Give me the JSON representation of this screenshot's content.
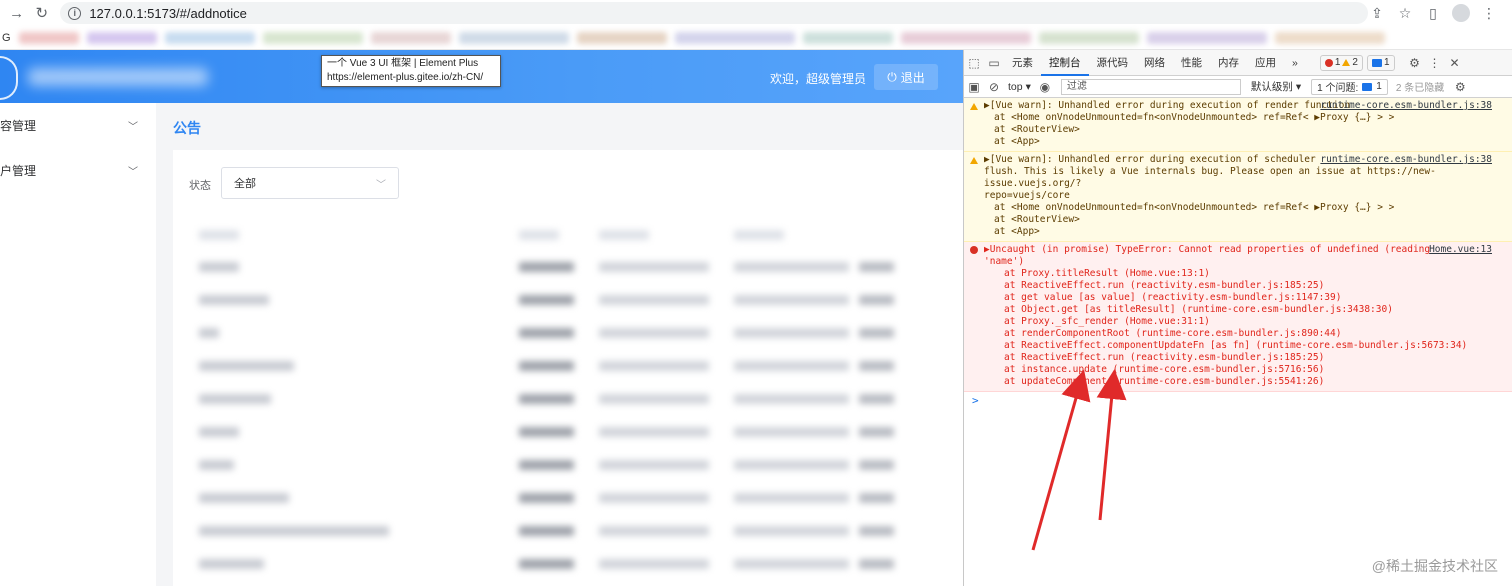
{
  "browser": {
    "url": "127.0.0.1:5173/#/addnotice",
    "bookmark_start": "G"
  },
  "tooltip": {
    "line1": "一个 Vue 3 UI 框架 | Element Plus",
    "line2": "https://element-plus.gitee.io/zh-CN/"
  },
  "app": {
    "welcome": "欢迎，超级管理员",
    "logout": "退出",
    "sidebar": [
      {
        "label": "容管理"
      },
      {
        "label": "户管理"
      }
    ],
    "page_title": "公告",
    "filter": {
      "label": "状态",
      "value": "全部"
    }
  },
  "devtools": {
    "tabs": [
      "元素",
      "控制台",
      "源代码",
      "网络",
      "性能",
      "内存",
      "应用"
    ],
    "more": "»",
    "counts": {
      "errors": "1",
      "warnings": "2",
      "info": "1"
    },
    "context": "top",
    "filter_placeholder": "过滤",
    "level": "默认级别",
    "issues": "1 个问题:",
    "issues_count": "1",
    "hidden": "2 条已隐藏",
    "messages": [
      {
        "level": "warn",
        "source": "runtime-core.esm-bundler.js:38",
        "lines": [
          "▶[Vue warn]: Unhandled error during execution of render function",
          "at <Home onVnodeUnmounted=fn<onVnodeUnmounted> ref=Ref< ▶Proxy {…} > >",
          "at <RouterView>",
          "at <App>"
        ]
      },
      {
        "level": "warn",
        "source": "runtime-core.esm-bundler.js:38",
        "lines": [
          "▶[Vue warn]: Unhandled error during execution of scheduler",
          "flush. This is likely a Vue internals bug. Please open an issue at https://new-issue.vuejs.org/?",
          "repo=vuejs/core",
          "at <Home onVnodeUnmounted=fn<onVnodeUnmounted> ref=Ref< ▶Proxy {…} > >",
          "at <RouterView>",
          "at <App>"
        ]
      },
      {
        "level": "err",
        "source": "Home.vue:13",
        "lines": [
          "▶Uncaught (in promise) TypeError: Cannot read properties of undefined (reading",
          "'name')",
          "at Proxy.titleResult (Home.vue:13:1)",
          "at ReactiveEffect.run (reactivity.esm-bundler.js:185:25)",
          "at get value [as value] (reactivity.esm-bundler.js:1147:39)",
          "at Object.get [as titleResult] (runtime-core.esm-bundler.js:3438:30)",
          "at Proxy._sfc_render (Home.vue:31:1)",
          "at renderComponentRoot (runtime-core.esm-bundler.js:890:44)",
          "at ReactiveEffect.componentUpdateFn [as fn] (runtime-core.esm-bundler.js:5673:34)",
          "at ReactiveEffect.run (reactivity.esm-bundler.js:185:25)",
          "at instance.update (runtime-core.esm-bundler.js:5716:56)",
          "at updateComponent (runtime-core.esm-bundler.js:5541:26)"
        ]
      }
    ],
    "prompt": ">"
  },
  "watermark": "@稀土掘金技术社区",
  "colors": {
    "accent": "#2f86f2",
    "error": "#e0251b",
    "warn_bg": "#fffbe5",
    "arrow": "#e02a2a"
  }
}
